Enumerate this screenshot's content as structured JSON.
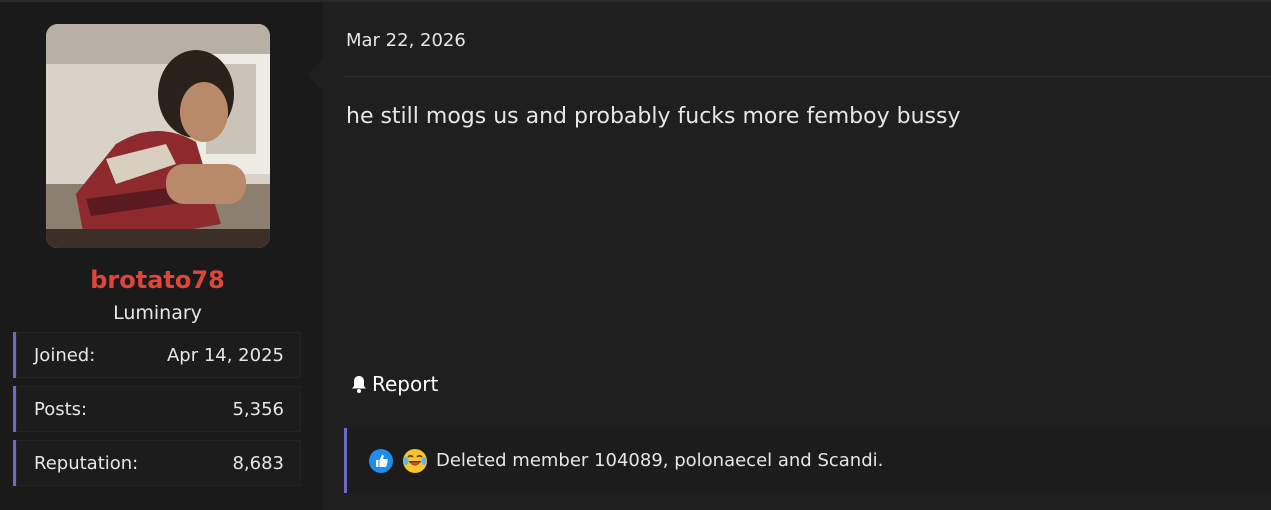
{
  "user": {
    "name": "brotato78",
    "title": "Luminary",
    "stats": [
      {
        "label": "Joined:",
        "value": "Apr 14, 2025"
      },
      {
        "label": "Posts:",
        "value": "5,356"
      },
      {
        "label": "Reputation:",
        "value": "8,683"
      }
    ]
  },
  "post": {
    "date": "Mar 22, 2026",
    "body": "he still mogs us and probably fucks more femboy bussy",
    "report_label": "Report",
    "reactions": {
      "icons": [
        "like-icon",
        "laughing-crying-emoji-icon"
      ],
      "text": "Deleted member 104089, polonaecel and Scandi."
    }
  },
  "colors": {
    "username": "#e0443a",
    "accent": "#6b6bc9",
    "like": "#1f8cf0"
  }
}
